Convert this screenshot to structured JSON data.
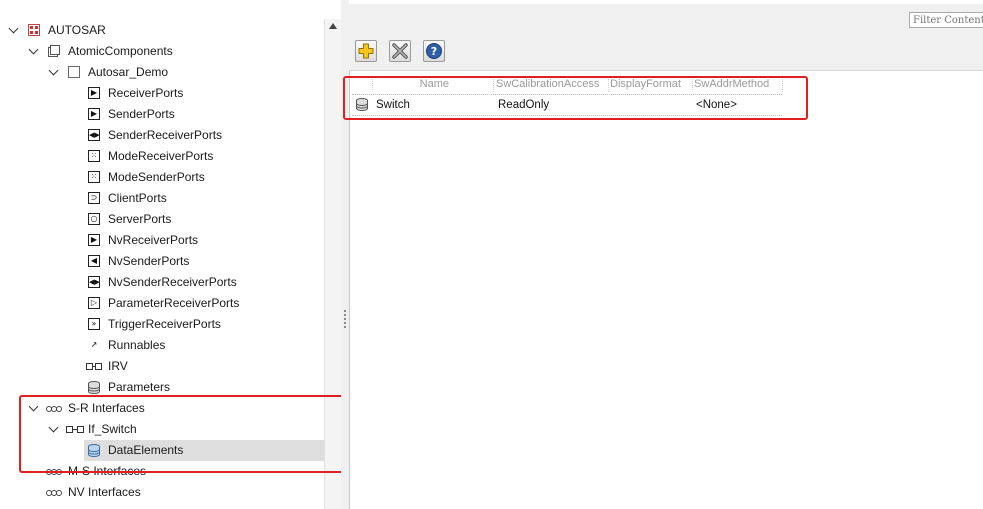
{
  "tree": {
    "items": [
      {
        "label": "AUTOSAR",
        "icon": "autosar-root-icon",
        "expanded": true,
        "level": 0
      },
      {
        "label": "AtomicComponents",
        "icon": "folder-icon",
        "expanded": true,
        "level": 1
      },
      {
        "label": "Autosar_Demo",
        "icon": "component-icon",
        "expanded": true,
        "level": 2
      },
      {
        "label": "ReceiverPorts",
        "icon": "receiver-port-icon",
        "level": 3
      },
      {
        "label": "SenderPorts",
        "icon": "sender-port-icon",
        "level": 3
      },
      {
        "label": "SenderReceiverPorts",
        "icon": "sender-receiver-port-icon",
        "level": 3
      },
      {
        "label": "ModeReceiverPorts",
        "icon": "mode-receiver-port-icon",
        "level": 3
      },
      {
        "label": "ModeSenderPorts",
        "icon": "mode-sender-port-icon",
        "level": 3
      },
      {
        "label": "ClientPorts",
        "icon": "client-port-icon",
        "level": 3
      },
      {
        "label": "ServerPorts",
        "icon": "server-port-icon",
        "level": 3
      },
      {
        "label": "NvReceiverPorts",
        "icon": "nv-receiver-port-icon",
        "level": 3
      },
      {
        "label": "NvSenderPorts",
        "icon": "nv-sender-port-icon",
        "level": 3
      },
      {
        "label": "NvSenderReceiverPorts",
        "icon": "nv-sender-receiver-port-icon",
        "level": 3
      },
      {
        "label": "ParameterReceiverPorts",
        "icon": "parameter-receiver-port-icon",
        "level": 3
      },
      {
        "label": "TriggerReceiverPorts",
        "icon": "trigger-receiver-port-icon",
        "level": 3
      },
      {
        "label": "Runnables",
        "icon": "runnable-icon",
        "level": 3
      },
      {
        "label": "IRV",
        "icon": "irv-icon",
        "level": 3
      },
      {
        "label": "Parameters",
        "icon": "database-icon",
        "level": 3
      },
      {
        "label": "S-R Interfaces",
        "icon": "interface-icon",
        "expanded": true,
        "level": 1
      },
      {
        "label": "If_Switch",
        "icon": "interface-icon",
        "expanded": true,
        "level": 2
      },
      {
        "label": "DataElements",
        "icon": "database-icon",
        "level": 3,
        "selected": true
      },
      {
        "label": "M-S Interfaces",
        "icon": "interface-icon",
        "level": 1
      },
      {
        "label": "NV Interfaces",
        "icon": "interface-icon",
        "level": 1
      }
    ]
  },
  "filter": {
    "placeholder": "Filter Contents"
  },
  "toolbar": {
    "add": "add-icon",
    "delete": "delete-icon",
    "help": "help-icon"
  },
  "table": {
    "columns": [
      "Name",
      "SwCalibrationAccess",
      "DisplayFormat",
      "SwAddrMethod"
    ],
    "rows": [
      {
        "name": "Switch",
        "calibration": "ReadOnly",
        "format": "",
        "addr": "<None>"
      }
    ]
  },
  "colors": {
    "highlight_box": "#e02020",
    "selection": "#dedede"
  }
}
